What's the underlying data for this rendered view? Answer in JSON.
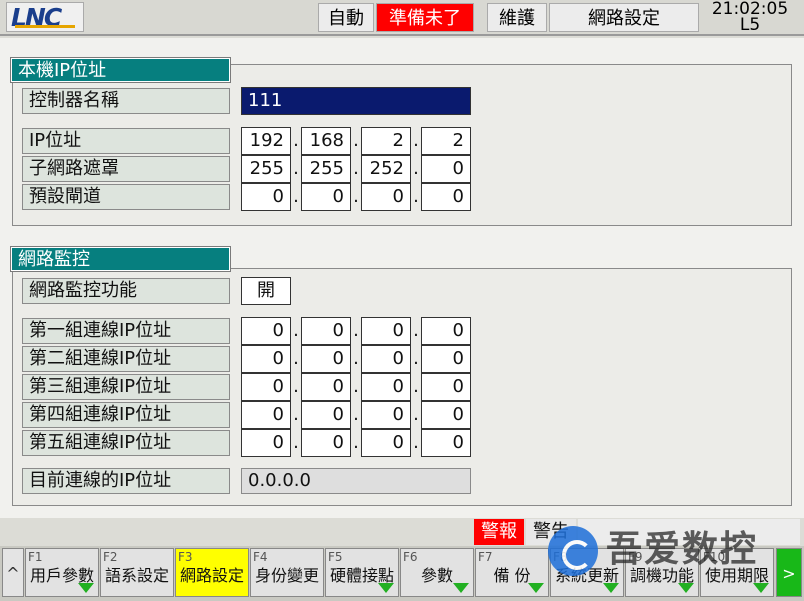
{
  "header": {
    "logo": "LNC",
    "mode": "自動",
    "status": "準備未了",
    "maintenance": "維護",
    "page_title": "網路設定",
    "time": "21:02:05",
    "level": "L5"
  },
  "colors": {
    "teal_title": "#067f7f",
    "name_field": "#0a1a6e",
    "alarm_red": "#ff0000",
    "active_key": "#ffff00",
    "green": "#22b022"
  },
  "local_ip": {
    "title": "本機IP位址",
    "controller_name_label": "控制器名稱",
    "controller_name": "111",
    "ip_label": "IP位址",
    "ip": [
      "192",
      "168",
      "2",
      "2"
    ],
    "subnet_label": "子網路遮罩",
    "subnet": [
      "255",
      "255",
      "252",
      "0"
    ],
    "gateway_label": "預設閘道",
    "gateway": [
      "0",
      "0",
      "0",
      "0"
    ]
  },
  "monitor": {
    "title": "網路監控",
    "function_label": "網路監控功能",
    "function_value": "開",
    "connections": [
      {
        "label": "第一組連線IP位址",
        "ip": [
          "0",
          "0",
          "0",
          "0"
        ]
      },
      {
        "label": "第二組連線IP位址",
        "ip": [
          "0",
          "0",
          "0",
          "0"
        ]
      },
      {
        "label": "第三組連線IP位址",
        "ip": [
          "0",
          "0",
          "0",
          "0"
        ]
      },
      {
        "label": "第四組連線IP位址",
        "ip": [
          "0",
          "0",
          "0",
          "0"
        ]
      },
      {
        "label": "第五組連線IP位址",
        "ip": [
          "0",
          "0",
          "0",
          "0"
        ]
      }
    ],
    "current_label": "目前連線的IP位址",
    "current_value": "0.0.0.0"
  },
  "alarm_bar": {
    "alarm": "警報",
    "warning": "警告"
  },
  "watermark": "吾爱数控",
  "function_keys": {
    "left_arrow": "^",
    "right_arrow": ">",
    "keys": [
      {
        "num": "F1",
        "label": "用戶參數"
      },
      {
        "num": "F2",
        "label": "語系設定"
      },
      {
        "num": "F3",
        "label": "網路設定"
      },
      {
        "num": "F4",
        "label": "身份變更"
      },
      {
        "num": "F5",
        "label": "硬體接點"
      },
      {
        "num": "F6",
        "label": "參數"
      },
      {
        "num": "F7",
        "label": "備 份"
      },
      {
        "num": "F8",
        "label": "系統更新"
      },
      {
        "num": "F9",
        "label": "調機功能"
      },
      {
        "num": "F10",
        "label": "使用期限"
      }
    ]
  }
}
